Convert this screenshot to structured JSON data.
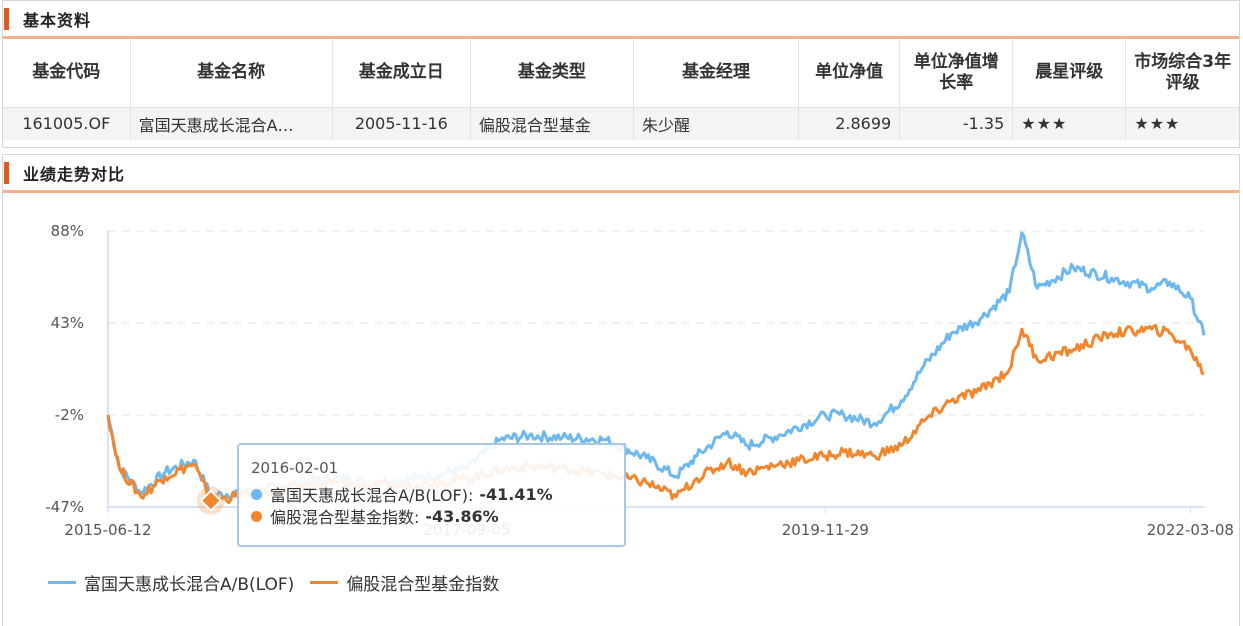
{
  "section1": {
    "title": "基本资料"
  },
  "table": {
    "headers": [
      "基金代码",
      "基金名称",
      "基金成立日",
      "基金类型",
      "基金经理",
      "单位净值",
      "单位净值增长率",
      "晨星评级",
      "市场综合3年评级"
    ],
    "row": {
      "code": "161005.OF",
      "name": "富国天惠成长混合A…",
      "inception": "2005-11-16",
      "type": "偏股混合型基金",
      "manager": "朱少醒",
      "nav": "2.8699",
      "nav_change": "-1.35",
      "morningstar": "★★★",
      "rating3y": "★★★"
    }
  },
  "section2": {
    "title": "业绩走势对比"
  },
  "colors": {
    "fund": "#6cb8ef",
    "index": "#f2862d",
    "accent": "#e05a1c",
    "stars": "#e4161d"
  },
  "chart_data": {
    "type": "line",
    "title": "",
    "ylabel": "",
    "y_unit": "%",
    "ylim": [
      -47,
      88
    ],
    "y_ticks": [
      "88%",
      "43%",
      "-2%",
      "-47%"
    ],
    "y_tick_values": [
      88,
      43,
      -2,
      -47
    ],
    "x_ticks": [
      "2015-06-12",
      "2017-09-05",
      "2019-11-29",
      "2022-03-08"
    ],
    "x_range": [
      "2015-06-12",
      "2022-04-08"
    ],
    "grid": true,
    "legend_position": "bottom-left",
    "series": [
      {
        "name": "富国天惠成长混合A/B(LOF)",
        "color": "#6cb8ef",
        "points": [
          [
            "2015-06-12",
            -2
          ],
          [
            "2015-07-08",
            -28
          ],
          [
            "2015-08-26",
            -40
          ],
          [
            "2015-10-20",
            -30
          ],
          [
            "2015-12-24",
            -24
          ],
          [
            "2016-02-01",
            -41.41
          ],
          [
            "2016-05-20",
            -39
          ],
          [
            "2016-08-20",
            -35
          ],
          [
            "2016-11-25",
            -33
          ],
          [
            "2017-01-20",
            -35
          ],
          [
            "2017-05-15",
            -33
          ],
          [
            "2017-09-05",
            -28
          ],
          [
            "2017-11-20",
            -14
          ],
          [
            "2018-01-25",
            -12
          ],
          [
            "2018-04-10",
            -13
          ],
          [
            "2018-07-15",
            -14
          ],
          [
            "2018-10-18",
            -23
          ],
          [
            "2018-12-25",
            -32
          ],
          [
            "2019-02-10",
            -22
          ],
          [
            "2019-04-20",
            -10
          ],
          [
            "2019-06-05",
            -17
          ],
          [
            "2019-08-15",
            -12
          ],
          [
            "2019-11-29",
            -2
          ],
          [
            "2020-01-10",
            -2
          ],
          [
            "2020-03-20",
            -6
          ],
          [
            "2020-05-20",
            5
          ],
          [
            "2020-07-10",
            22
          ],
          [
            "2020-09-10",
            38
          ],
          [
            "2020-11-15",
            45
          ],
          [
            "2021-01-20",
            58
          ],
          [
            "2021-02-18",
            87
          ],
          [
            "2021-03-25",
            60
          ],
          [
            "2021-06-15",
            70
          ],
          [
            "2021-09-10",
            65
          ],
          [
            "2021-12-10",
            60
          ],
          [
            "2022-01-20",
            63
          ],
          [
            "2022-03-08",
            55
          ],
          [
            "2022-04-08",
            37
          ]
        ]
      },
      {
        "name": "偏股混合型基金指数",
        "color": "#f2862d",
        "points": [
          [
            "2015-06-12",
            -2
          ],
          [
            "2015-07-08",
            -28
          ],
          [
            "2015-08-26",
            -42
          ],
          [
            "2015-10-20",
            -32
          ],
          [
            "2015-12-24",
            -26
          ],
          [
            "2016-02-01",
            -43.86
          ],
          [
            "2016-05-20",
            -40
          ],
          [
            "2016-08-20",
            -37
          ],
          [
            "2016-11-25",
            -35
          ],
          [
            "2017-01-20",
            -37
          ],
          [
            "2017-05-15",
            -36
          ],
          [
            "2017-09-05",
            -33
          ],
          [
            "2017-11-20",
            -29
          ],
          [
            "2018-01-25",
            -27
          ],
          [
            "2018-04-10",
            -28
          ],
          [
            "2018-07-15",
            -31
          ],
          [
            "2018-10-18",
            -35
          ],
          [
            "2018-12-25",
            -42
          ],
          [
            "2019-02-10",
            -33
          ],
          [
            "2019-04-20",
            -25
          ],
          [
            "2019-06-05",
            -30
          ],
          [
            "2019-08-15",
            -26
          ],
          [
            "2019-11-29",
            -22
          ],
          [
            "2020-01-10",
            -20
          ],
          [
            "2020-03-20",
            -22
          ],
          [
            "2020-05-20",
            -17
          ],
          [
            "2020-07-10",
            -5
          ],
          [
            "2020-09-10",
            5
          ],
          [
            "2020-11-15",
            10
          ],
          [
            "2021-01-20",
            20
          ],
          [
            "2021-02-18",
            40
          ],
          [
            "2021-03-25",
            25
          ],
          [
            "2021-06-15",
            30
          ],
          [
            "2021-09-10",
            38
          ],
          [
            "2021-12-10",
            40
          ],
          [
            "2022-01-20",
            38
          ],
          [
            "2022-03-08",
            30
          ],
          [
            "2022-04-08",
            18
          ]
        ]
      }
    ],
    "tooltip": {
      "date": "2016-02-01",
      "rows": [
        {
          "name": "富国天惠成长混合A/B(LOF):",
          "value": "-41.41%"
        },
        {
          "name": "偏股混合型基金指数:",
          "value": "-43.86%"
        }
      ]
    }
  }
}
